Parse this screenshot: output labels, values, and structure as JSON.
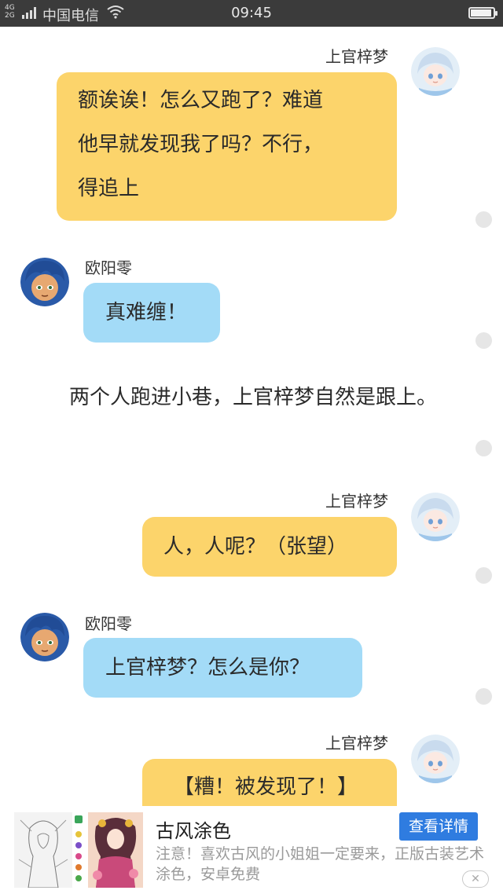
{
  "status_bar": {
    "network_top": "4G",
    "network_bottom": "2G",
    "carrier": "中国电信",
    "time": "09:45",
    "battery_level": 0.92
  },
  "messages": [
    {
      "speaker": "上官梓梦",
      "lines": [
        "额诶诶！怎么又跑了？难道",
        "他早就发现我了吗？不行，",
        "得追上"
      ]
    },
    {
      "speaker": "欧阳零",
      "lines": [
        "真难缠！"
      ]
    },
    {
      "narration": "两个人跑进小巷，上官梓梦自然是跟上。"
    },
    {
      "speaker": "上官梓梦",
      "lines": [
        "人，人呢？（张望）"
      ]
    },
    {
      "speaker": "欧阳零",
      "lines": [
        "上官梓梦？怎么是你？"
      ]
    },
    {
      "speaker": "上官梓梦",
      "lines": [
        "【糟！被发现了！】"
      ]
    }
  ],
  "ad": {
    "title": "古风涂色",
    "button_label": "查看详情",
    "description": "注意！喜欢古风的小姐姐一定要来，正版古装艺术涂色，安卓免费",
    "close_icon": "close-icon"
  },
  "colors": {
    "status_bar_bg": "#3b3b3b",
    "bubble_yellow": "#fcd46b",
    "bubble_blue": "#a3dbf7",
    "ad_button": "#2f7ce0"
  }
}
